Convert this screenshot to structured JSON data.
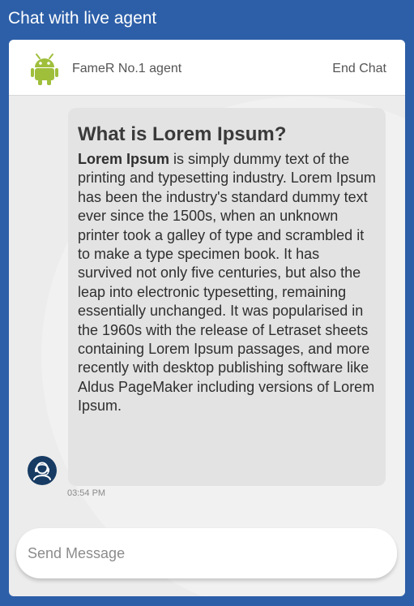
{
  "app": {
    "title": "Chat with live agent"
  },
  "header": {
    "agent_name": "FameR No.1 agent",
    "end_chat_label": "End Chat",
    "avatar_icon": "android-robot-icon"
  },
  "messages": [
    {
      "heading": "What is Lorem Ipsum?",
      "lead": "Lorem Ipsum",
      "body": " is simply dummy text of the printing and typesetting industry. Lorem Ipsum has been the industry's standard dummy text ever since the 1500s, when an unknown printer took a galley of type and scrambled it to make a type specimen book. It has survived not only five centuries, but also the leap into electronic typesetting, remaining essentially unchanged. It was popularised in the 1960s with the release of Letraset sheets containing Lorem Ipsum passages, and more recently with desktop publishing software like Aldus PageMaker including versions of Lorem Ipsum.",
      "time": "03:54 PM",
      "sender_icon": "support-agent-avatar-icon"
    }
  ],
  "composer": {
    "placeholder": "Send Message",
    "value": ""
  },
  "colors": {
    "brand_blue": "#2d5fa8",
    "panel_bg": "#ececec",
    "bubble_bg": "#e3e3e3",
    "android_green": "#9fbf3b",
    "avatar_navy": "#173b63"
  }
}
